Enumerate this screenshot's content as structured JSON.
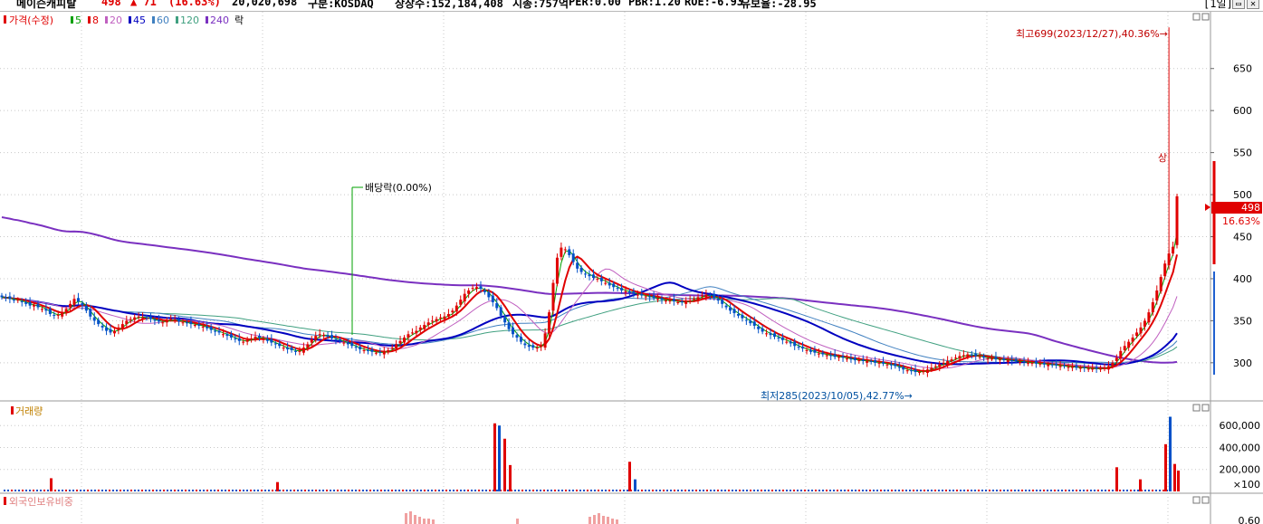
{
  "topbar": {
    "name": "메이슨캐피탈",
    "price": "498",
    "change": "▲ 71",
    "change_pct": "(16.63%)",
    "volume": "20,020,698",
    "market": "구분:KOSDAQ",
    "shares": "상장수:152,184,408",
    "mcap": "시총:757억",
    "per": "PER:0.00",
    "pbr": "PBR:1.20",
    "roe": "ROE:-6.93",
    "float": "유보율:-28.95",
    "period_button": "1일"
  },
  "price_panel": {
    "legend_price": "가격(수정)",
    "legend_ma": [
      {
        "label": "5",
        "color": "#00a000"
      },
      {
        "label": "8",
        "color": "#e00000"
      },
      {
        "label": "20",
        "color": "#c060c0"
      },
      {
        "label": "45",
        "color": "#0000c0"
      },
      {
        "label": "60",
        "color": "#4080c0"
      },
      {
        "label": "120",
        "color": "#40a080"
      },
      {
        "label": "240",
        "color": "#7a30c0"
      }
    ],
    "legend_event": "락",
    "y_ticks": [
      "650",
      "600",
      "550",
      "500",
      "450",
      "400",
      "350",
      "300"
    ],
    "y_tick_values": [
      650,
      600,
      550,
      500,
      450,
      400,
      350,
      300
    ],
    "current_price_box": "498",
    "current_pct": "16.63%",
    "annotation_high": "최고699(2023/12/27),40.36%→",
    "annotation_low": "최저285(2023/10/05),42.77%→",
    "annotation_dividend": "배당락(0.00%)",
    "annotation_up": "상"
  },
  "volume_panel": {
    "title": "거래량",
    "y_ticks": [
      "600,000",
      "400,000",
      "200,000"
    ],
    "y_tick_values": [
      600000,
      400000,
      200000
    ],
    "unit": "×100"
  },
  "foreign_panel": {
    "title": "외국인보유비중",
    "y_tick_partial": "0.60"
  },
  "chart_data": {
    "type": "candlestick",
    "ylim_price": [
      260,
      710
    ],
    "ylim_volume": [
      0,
      750000
    ],
    "high": 699,
    "low": 285,
    "last_close": 498,
    "close_series_approx": [
      378,
      377,
      376,
      374,
      375,
      372,
      370,
      368,
      369,
      366,
      364,
      362,
      358,
      356,
      357,
      360,
      364,
      370,
      376,
      373,
      368,
      362,
      355,
      350,
      346,
      342,
      338,
      336,
      338,
      342,
      346,
      350,
      352,
      354,
      355,
      354,
      353,
      352,
      350,
      349,
      348,
      350,
      352,
      351,
      349,
      348,
      347,
      346,
      345,
      344,
      343,
      341,
      339,
      337,
      336,
      334,
      332,
      330,
      328,
      326,
      325,
      327,
      329,
      331,
      330,
      328,
      326,
      324,
      322,
      320,
      318,
      316,
      315,
      313,
      314,
      318,
      322,
      328,
      332,
      334,
      333,
      331,
      329,
      327,
      326,
      324,
      322,
      320,
      318,
      316,
      315,
      314,
      313,
      312,
      312,
      313,
      315,
      318,
      322,
      326,
      330,
      334,
      336,
      338,
      342,
      345,
      348,
      350,
      352,
      354,
      355,
      358,
      362,
      368,
      375,
      382,
      386,
      389,
      390,
      388,
      384,
      378,
      372,
      365,
      356,
      348,
      340,
      334,
      330,
      325,
      321,
      319,
      318,
      318,
      320,
      335,
      360,
      395,
      425,
      437,
      435,
      428,
      420,
      412,
      408,
      405,
      403,
      401,
      400,
      397,
      395,
      392,
      390,
      388,
      386,
      385,
      383,
      382,
      381,
      380,
      379,
      378,
      377,
      376,
      375,
      374,
      374,
      373,
      372,
      372,
      373,
      374,
      376,
      378,
      380,
      381,
      380,
      377,
      374,
      370,
      366,
      362,
      359,
      356,
      353,
      350,
      347,
      344,
      340,
      337,
      335,
      333,
      331,
      329,
      327,
      325,
      323,
      320,
      318,
      317,
      315,
      313,
      312,
      311,
      310,
      309,
      308,
      307,
      307,
      306,
      305,
      304,
      303,
      303,
      302,
      302,
      301,
      300,
      300,
      299,
      298,
      297,
      296,
      294,
      292,
      291,
      290,
      289,
      289,
      290,
      292,
      294,
      296,
      298,
      300,
      302,
      304,
      306,
      308,
      309,
      310,
      309,
      308,
      307,
      306,
      305,
      305,
      304,
      304,
      303,
      303,
      302,
      302,
      301,
      301,
      300,
      300,
      299,
      299,
      298,
      298,
      297,
      297,
      296,
      296,
      295,
      295,
      294,
      294,
      294,
      293,
      293,
      293,
      293,
      294,
      296,
      300,
      306,
      314,
      320,
      325,
      330,
      336,
      342,
      350,
      360,
      372,
      386,
      402,
      418,
      430,
      438,
      498
    ],
    "volume_series_approx": [
      {
        "idx": 55,
        "value": 120000
      },
      {
        "idx": 305,
        "value": 85000
      },
      {
        "idx": 545,
        "value": 620000
      },
      {
        "idx": 550,
        "value": 600000
      },
      {
        "idx": 556,
        "value": 480000
      },
      {
        "idx": 562,
        "value": 240000
      },
      {
        "idx": 694,
        "value": 270000
      },
      {
        "idx": 700,
        "value": 110000
      },
      {
        "idx": 1232,
        "value": 220000
      },
      {
        "idx": 1258,
        "value": 110000
      },
      {
        "idx": 1286,
        "value": 430000
      },
      {
        "idx": 1291,
        "value": 680000
      },
      {
        "idx": 1296,
        "value": 250000
      },
      {
        "idx": 1300,
        "value": 190000
      }
    ]
  },
  "colors": {
    "up": "#e00000",
    "down": "#0050c8",
    "ma5": "#00a000",
    "ma8": "#e00000",
    "ma20": "#c060c0",
    "ma45": "#0000c0",
    "ma60": "#4080c0",
    "ma120": "#40a080",
    "ma240": "#7a30c0",
    "grid": "#c8c8c8"
  }
}
